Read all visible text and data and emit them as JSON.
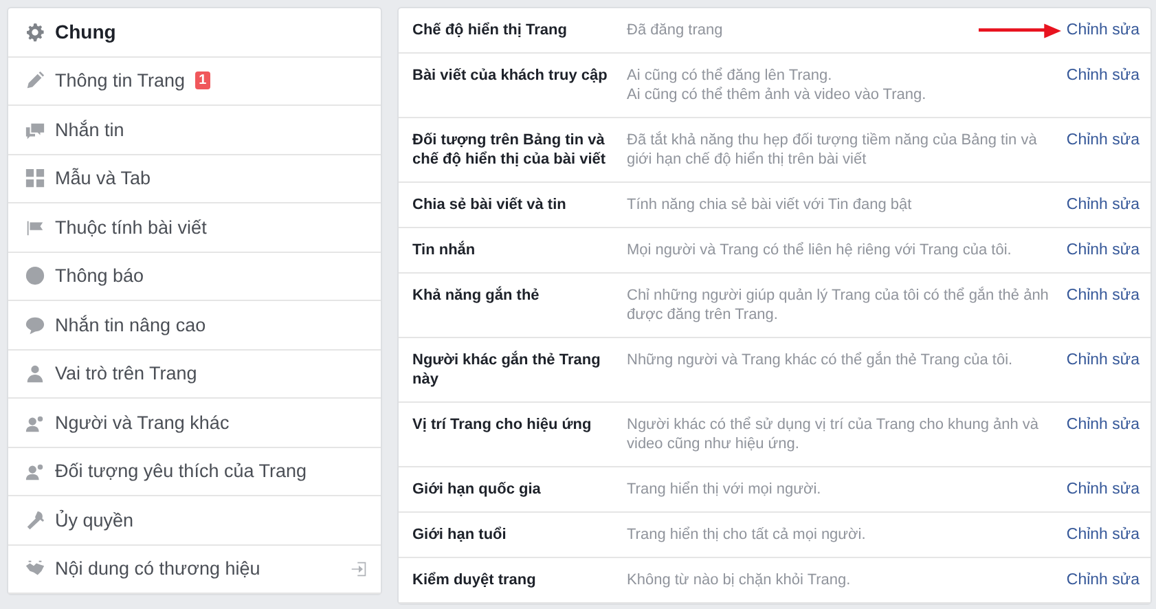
{
  "sidebar": {
    "items": [
      {
        "label": "Chung",
        "selected": true
      },
      {
        "label": "Thông tin Trang",
        "selected": false,
        "badge": "1"
      },
      {
        "label": "Nhắn tin",
        "selected": false
      },
      {
        "label": "Mẫu và Tab",
        "selected": false
      },
      {
        "label": "Thuộc tính bài viết",
        "selected": false
      },
      {
        "label": "Thông báo",
        "selected": false
      },
      {
        "label": "Nhắn tin nâng cao",
        "selected": false
      },
      {
        "label": "Vai trò trên Trang",
        "selected": false
      },
      {
        "label": "Người và Trang khác",
        "selected": false
      },
      {
        "label": "Đối tượng yêu thích của Trang",
        "selected": false
      },
      {
        "label": "Ủy quyền",
        "selected": false
      },
      {
        "label": "Nội dung có thương hiệu",
        "selected": false
      }
    ]
  },
  "settings": {
    "rows": [
      {
        "label": "Chế độ hiển thị Trang",
        "value": "Đã đăng trang",
        "action": "Chỉnh sửa",
        "arrow": true
      },
      {
        "label": "Bài viết của khách truy cập",
        "value": "Ai cũng có thể đăng lên Trang.\nAi cũng có thể thêm ảnh và video vào Trang.",
        "action": "Chỉnh sửa",
        "arrow": false
      },
      {
        "label": "Đối tượng trên Bảng tin và\nchế độ hiển thị của bài viết",
        "value": "Đã tắt khả năng thu hẹp đối tượng tiềm năng của Bảng tin và\ngiới hạn chế độ hiển thị trên bài viết",
        "action": "Chỉnh sửa",
        "arrow": false
      },
      {
        "label": "Chia sẻ bài viết và tin",
        "value": "Tính năng chia sẻ bài viết với Tin đang bật",
        "action": "Chỉnh sửa",
        "arrow": false
      },
      {
        "label": "Tin nhắn",
        "value": "Mọi người và Trang có thể liên hệ riêng với Trang của tôi.",
        "action": "Chỉnh sửa",
        "arrow": false
      },
      {
        "label": "Khả năng gắn thẻ",
        "value": "Chỉ những người giúp quản lý Trang của tôi có thể gắn thẻ ảnh\nđược đăng trên Trang.",
        "action": "Chỉnh sửa",
        "arrow": false
      },
      {
        "label": "Người khác gắn thẻ Trang\nnày",
        "value": "Những người và Trang khác có thể gắn thẻ Trang của tôi.",
        "action": "Chỉnh sửa",
        "arrow": false
      },
      {
        "label": "Vị trí Trang cho hiệu ứng",
        "value": "Người khác có thể sử dụng vị trí của Trang cho khung ảnh và\nvideo cũng như hiệu ứng.",
        "action": "Chỉnh sửa",
        "arrow": false
      },
      {
        "label": "Giới hạn quốc gia",
        "value": "Trang hiển thị với mọi người.",
        "action": "Chỉnh sửa",
        "arrow": false
      },
      {
        "label": "Giới hạn tuổi",
        "value": "Trang hiển thị cho tất cả mọi người.",
        "action": "Chỉnh sửa",
        "arrow": false
      },
      {
        "label": "Kiểm duyệt trang",
        "value": "Không từ nào bị chặn khỏi Trang.",
        "action": "Chỉnh sửa",
        "arrow": false
      }
    ]
  }
}
